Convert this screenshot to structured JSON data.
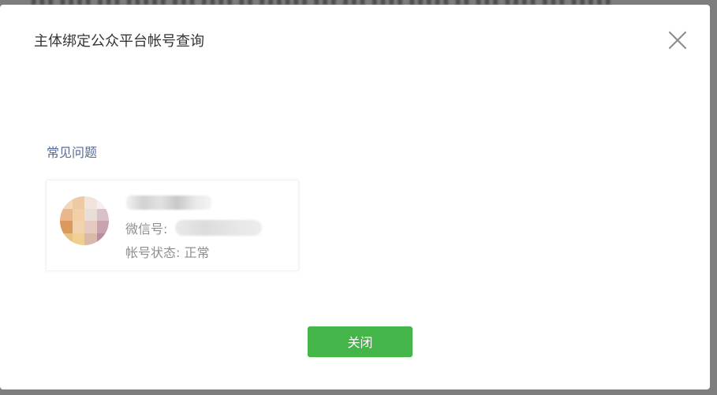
{
  "background": {
    "overlay_color": "#7d7d7d"
  },
  "dialog": {
    "title": "主体绑定公众平台帐号查询",
    "faq_link": "常见问题",
    "account": {
      "wechat_id_label": "微信号:",
      "status_label": "帐号状态:",
      "status_value": "正常"
    },
    "close_button_label": "关闭",
    "accent_color": "#44b549",
    "link_color": "#576b95"
  }
}
